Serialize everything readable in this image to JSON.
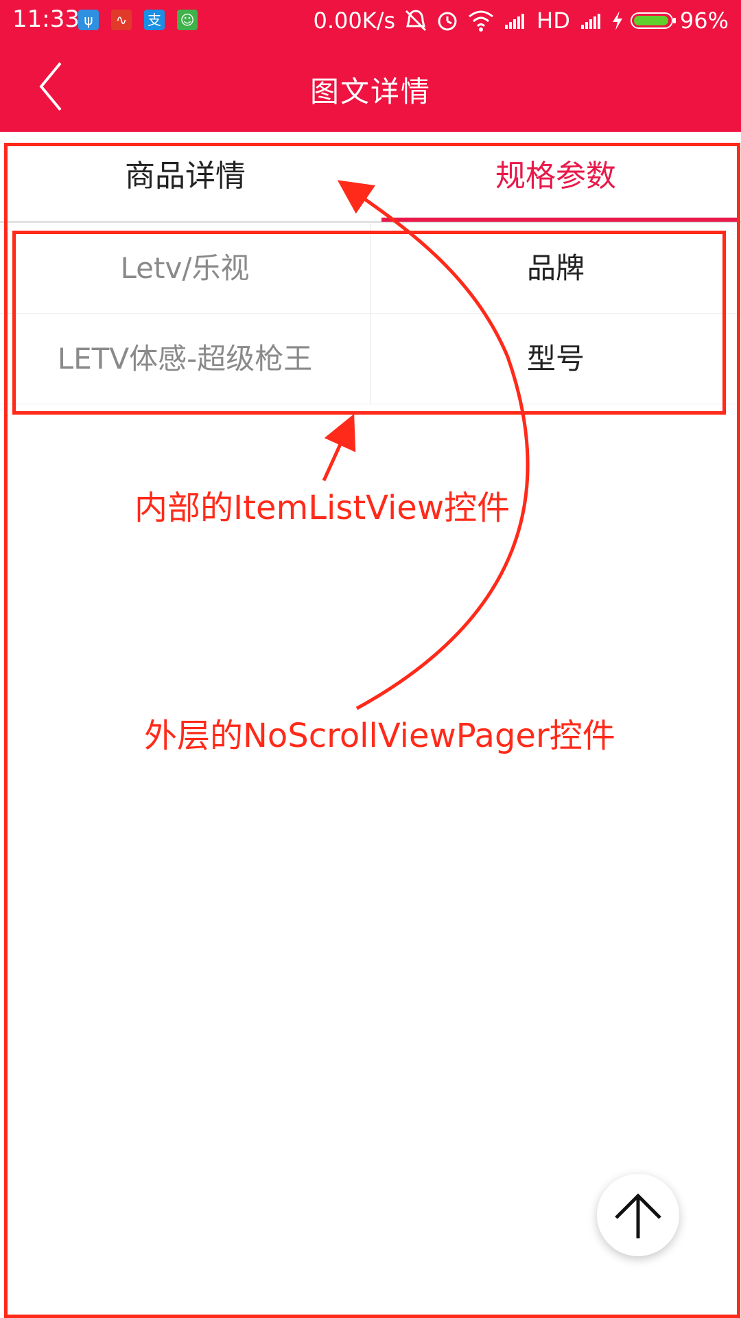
{
  "status_bar": {
    "time": "11:33",
    "net_speed": "0.00K/s",
    "network_type": "HD",
    "battery_percent": "96%",
    "battery_level": 0.96,
    "notification_icons": [
      {
        "name": "usb-icon",
        "glyph": "ψ",
        "color": "#2f8fe0"
      },
      {
        "name": "app-red-icon",
        "glyph": "∿",
        "color": "#e23a2a"
      },
      {
        "name": "alipay-icon",
        "glyph": "支",
        "color": "#1a8fe3"
      },
      {
        "name": "android-icon",
        "glyph": "☺",
        "color": "#3fb24a"
      }
    ]
  },
  "title_bar": {
    "title": "图文详情",
    "back_icon": "chevron-left-icon"
  },
  "tabs": [
    {
      "label": "商品详情",
      "active": false
    },
    {
      "label": "规格参数",
      "active": true
    }
  ],
  "spec_table": {
    "rows": [
      {
        "value": "Letv/乐视",
        "label": "品牌"
      },
      {
        "value": "LETV体感-超级枪王",
        "label": "型号"
      }
    ]
  },
  "annotations": {
    "inner_label": "内部的ItemListView控件",
    "outer_label": "外层的NoScrollViewPager控件",
    "color": "#ff2a1a"
  },
  "fab": {
    "icon": "arrow-up-icon"
  },
  "colors": {
    "brand_red": "#ee1340",
    "active_tab": "#e8194a"
  }
}
